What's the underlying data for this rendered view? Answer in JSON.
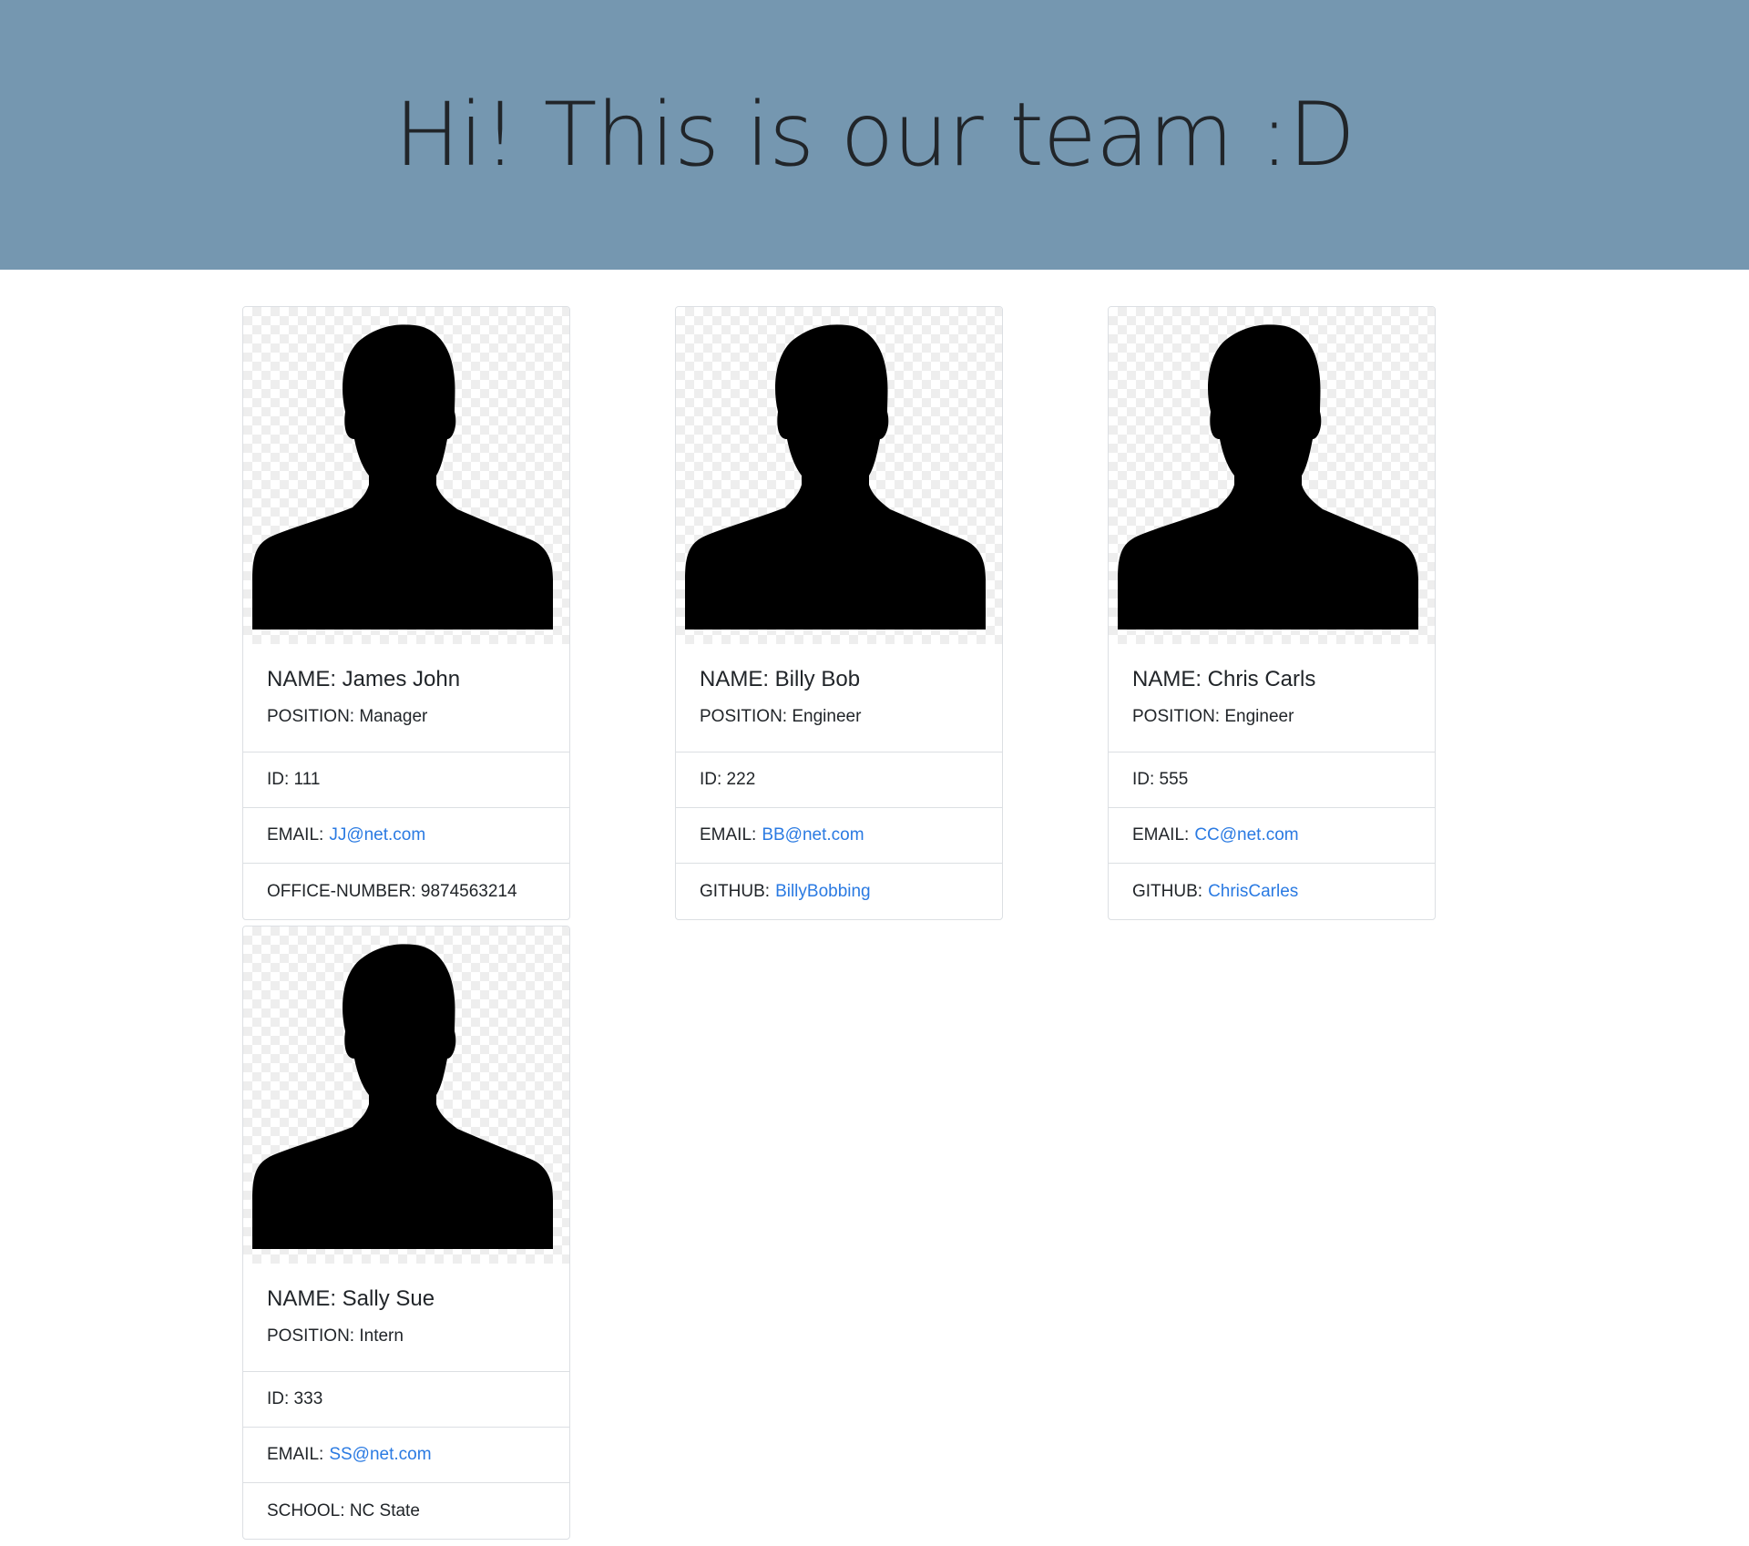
{
  "header": {
    "title": "Hi! This is our team :D"
  },
  "colors": {
    "header_bg": "#7597b0",
    "link": "#2a7ae2",
    "border": "#dcdfe3"
  },
  "members": [
    {
      "name": "NAME: James John",
      "position": "POSITION: Manager",
      "id": "ID: 111",
      "email_label": "EMAIL:",
      "email": "JJ@net.com",
      "extra_label": "OFFICE-NUMBER:",
      "extra_value": "9874563214",
      "photo_icon": "person-silhouette-icon"
    },
    {
      "name": "NAME: Billy Bob",
      "position": "POSITION: Engineer",
      "id": "ID: 222",
      "email_label": "EMAIL:",
      "email": "BB@net.com",
      "extra_label": "GITHUB:",
      "extra_value": "BillyBobbing",
      "photo_icon": "person-silhouette-icon"
    },
    {
      "name": "NAME: Chris Carls",
      "position": "POSITION: Engineer",
      "id": "ID: 555",
      "email_label": "EMAIL:",
      "email": "CC@net.com",
      "extra_label": "GITHUB:",
      "extra_value": "ChrisCarles",
      "photo_icon": "person-silhouette-icon"
    },
    {
      "name": "NAME: Sally Sue",
      "position": "POSITION: Intern",
      "id": "ID: 333",
      "email_label": "EMAIL:",
      "email": "SS@net.com",
      "extra_label": "SCHOOL:",
      "extra_value": "NC State",
      "photo_icon": "person-silhouette-icon"
    }
  ]
}
